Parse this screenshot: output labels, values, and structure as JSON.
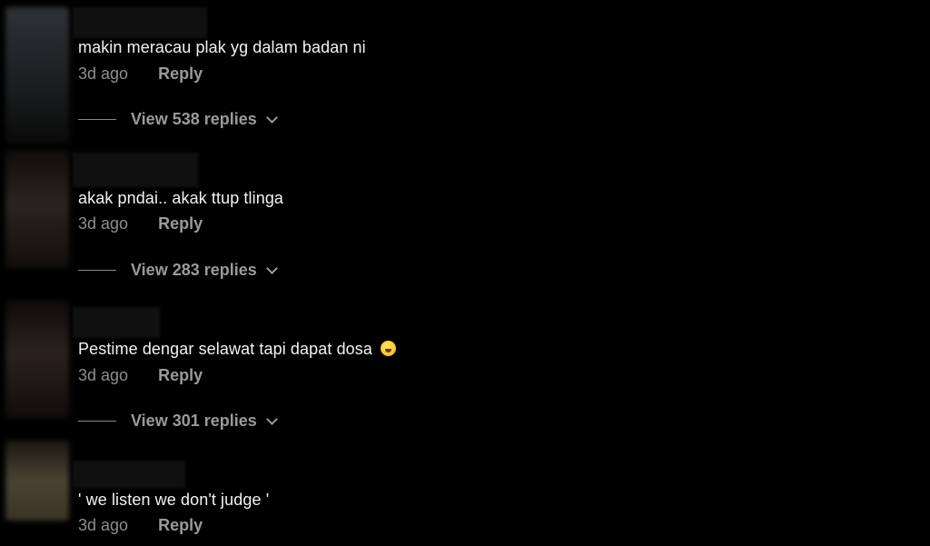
{
  "comments": [
    {
      "text": "makin meracau plak yg dalam badan ni",
      "time": "3d ago",
      "reply_label": "Reply",
      "view_replies": "View 538 replies",
      "avatar_color": "#2f3235"
    },
    {
      "text": "akak pndai.. akak ttup tlinga",
      "time": "3d ago",
      "reply_label": "Reply",
      "view_replies": "View 283 replies",
      "avatar_color": "#2b231f"
    },
    {
      "text": "Pestime dengar selawat tapi dapat dosa",
      "emoji": "loudly-crying-face-emoji",
      "time": "3d ago",
      "reply_label": "Reply",
      "view_replies": "View 301 replies",
      "avatar_color": "#2a211f"
    },
    {
      "text": "' we listen we don't judge '",
      "time": "3d ago",
      "reply_label": "Reply",
      "avatar_color": "#4a4332"
    }
  ]
}
